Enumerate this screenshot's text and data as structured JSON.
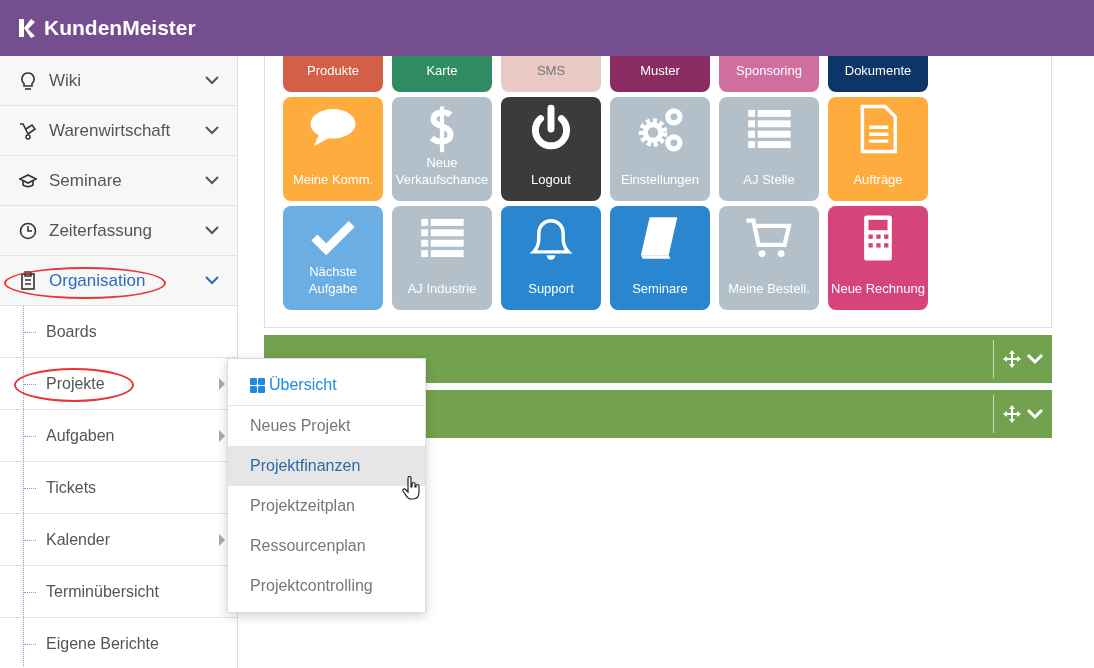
{
  "app": {
    "title": "KundenMeister"
  },
  "sidebar": {
    "items": [
      {
        "label": "Wiki",
        "active": false,
        "annotated": false
      },
      {
        "label": "Warenwirtschaft",
        "active": false,
        "annotated": false
      },
      {
        "label": "Seminare",
        "active": false,
        "annotated": false
      },
      {
        "label": "Zeiterfassung",
        "active": false,
        "annotated": false
      },
      {
        "label": "Organisation",
        "active": true,
        "annotated": true,
        "children": [
          {
            "label": "Boards",
            "has_submenu": false,
            "annotated": false
          },
          {
            "label": "Projekte",
            "has_submenu": true,
            "annotated": true
          },
          {
            "label": "Aufgaben",
            "has_submenu": true,
            "annotated": false
          },
          {
            "label": "Tickets",
            "has_submenu": false,
            "annotated": false
          },
          {
            "label": "Kalender",
            "has_submenu": true,
            "annotated": false
          },
          {
            "label": "Terminübersicht",
            "has_submenu": false,
            "annotated": false
          },
          {
            "label": "Eigene Berichte",
            "has_submenu": false,
            "annotated": false
          }
        ]
      }
    ]
  },
  "tiles_partly_hidden": [
    {
      "label": "Produkte",
      "color": "#d35f46"
    },
    {
      "label": "Karte",
      "color": "#2e8b62"
    },
    {
      "label": "SMS",
      "color": "#e8c9c4"
    },
    {
      "label": "Muster",
      "color": "#892c62"
    },
    {
      "label": "Sponsoring",
      "color": "#d06ea0"
    },
    {
      "label": "Dokumente",
      "color": "#0d3568"
    }
  ],
  "tiles": [
    {
      "label": "Meine Komm.",
      "color": "#ffac3e"
    },
    {
      "label": "Neue Verkaufschance",
      "color": "#b3bfc9"
    },
    {
      "label": "Logout",
      "color": "#3b3b3b"
    },
    {
      "label": "Einstellungen",
      "color": "#b3bfc9"
    },
    {
      "label": "AJ Stelle",
      "color": "#b3bfc9"
    },
    {
      "label": "Aufträge",
      "color": "#ffac3e"
    },
    {
      "label": "Nächste Aufgabe",
      "color": "#6aaee3"
    },
    {
      "label": "AJ Industrie",
      "color": "#b3bfc9"
    },
    {
      "label": "Support",
      "color": "#2a86cf"
    },
    {
      "label": "Seminare",
      "color": "#2a86cf"
    },
    {
      "label": "Meine Bestell.",
      "color": "#b3bfc9"
    },
    {
      "label": "Neue Rechnung",
      "color": "#d5457a"
    }
  ],
  "widgets": [
    {
      "expanded": false
    },
    {
      "expanded": false
    }
  ],
  "submenu": {
    "header": "Übersicht",
    "items": [
      {
        "label": "Neues Projekt",
        "selected": false
      },
      {
        "label": "Projektfinanzen",
        "selected": true
      },
      {
        "label": "Projektzeitplan",
        "selected": false
      },
      {
        "label": "Ressourcenplan",
        "selected": false
      },
      {
        "label": "Projektcontrolling",
        "selected": false
      }
    ]
  }
}
